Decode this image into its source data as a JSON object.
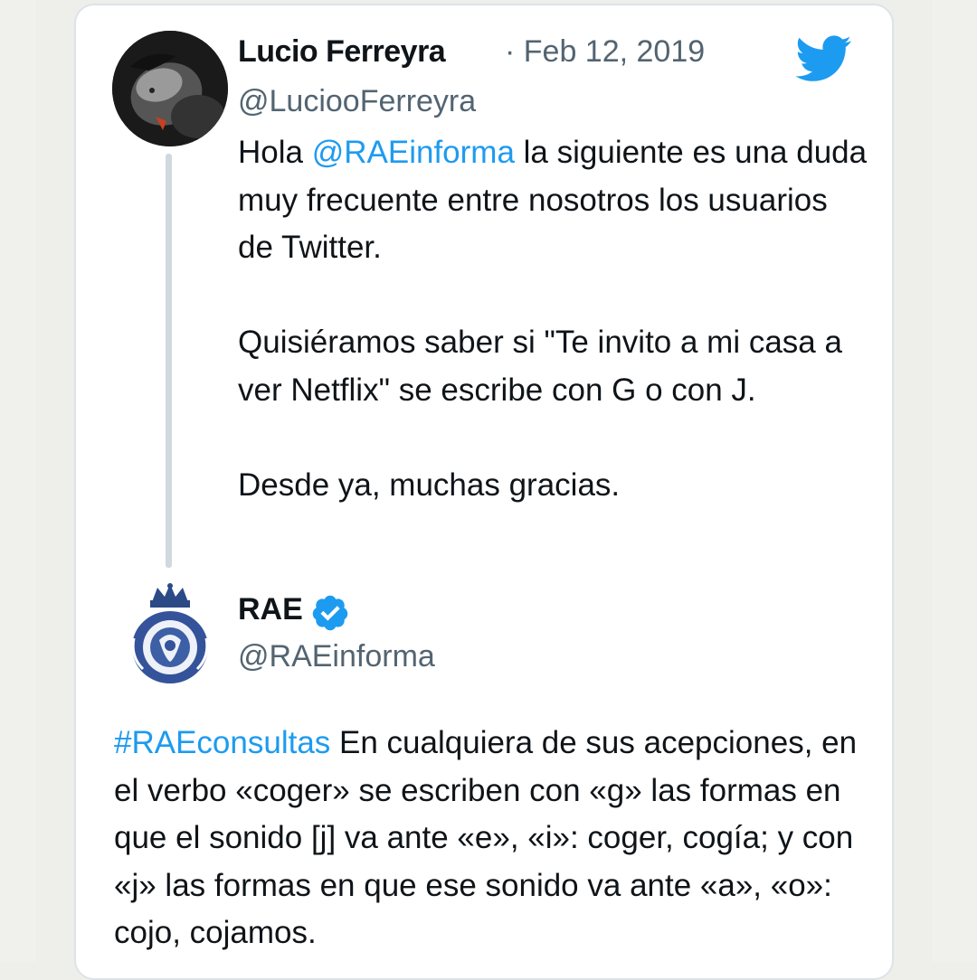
{
  "tweet": {
    "author_name": "Lucio Ferreyra",
    "date": "· Feb 12, 2019",
    "handle": "@LuciooFerreyra",
    "mention": "@RAEinforma",
    "line1_rest": " la siguiente es una duda muy frecuente entre nosotros los usuarios de Twitter.",
    "paragraph2": "Quisiéramos saber si \"Te invito a mi casa a ver Netflix\" se escribe con G o con J.",
    "paragraph3": "Desde ya, muchas gracias.",
    "greeting": "Hola "
  },
  "reply": {
    "author_name": "RAE",
    "handle": "@RAEinforma",
    "hashtag": "#RAEconsultas",
    "text": " En cualquiera de sus acepciones, en el verbo «coger» se escriben con «g» las formas en que el sonido [j] va ante «e», «i»: coger, cogía; y con «j» las formas en que ese sonido va ante «a», «o»: cojo, cojamos."
  },
  "icons": {
    "platform": "twitter-bird-icon",
    "verified": "verified-badge-icon"
  },
  "colors": {
    "link": "#1d9bf0",
    "text": "#0f1419",
    "secondary": "#536471"
  }
}
